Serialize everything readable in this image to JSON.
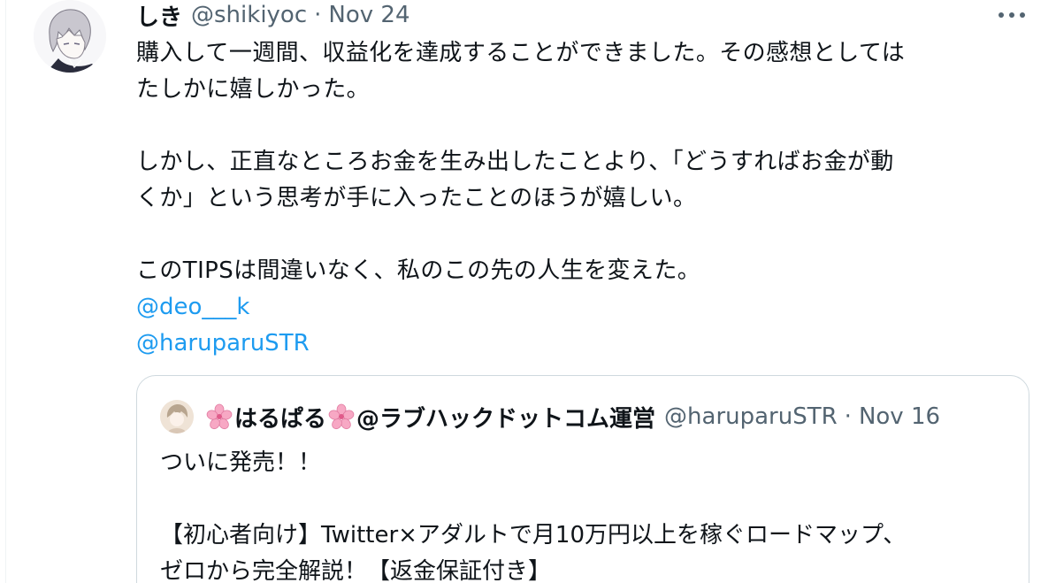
{
  "tweet": {
    "display_name": "しき",
    "handle": "@shikiyoc",
    "separator": "·",
    "date": "Nov 24",
    "more_icon": "more-horizontal-icon",
    "lines": [
      "購入して一週間、収益化を達成することができました。その感想としては",
      "たしかに嬉しかった。",
      "",
      "しかし、正直なところお金を生み出したことより、「どうすればお金が動",
      "くか」という思考が手に入ったことのほうが嬉しい。",
      "",
      "このTIPSは間違いなく、私のこの先の人生を変えた。"
    ],
    "mentions": [
      "@deo___k",
      "@haruparuSTR"
    ]
  },
  "quote": {
    "name": "はるぱる",
    "name_suffix": "@ラブハックドットコム運営",
    "handle": "@haruparuSTR",
    "separator": "·",
    "date": "Nov 16",
    "lines": [
      "ついに発売！！",
      "",
      "【初心者向け】Twitter×アダルトで月10万円以上を稼ぐロードマップ、",
      "ゼロから完全解説！【返金保証付き】"
    ]
  },
  "colors": {
    "link": "#1d9bf0",
    "secondary_text": "#536471",
    "border": "#cfd9de",
    "sakura": "#f7a8c4"
  }
}
